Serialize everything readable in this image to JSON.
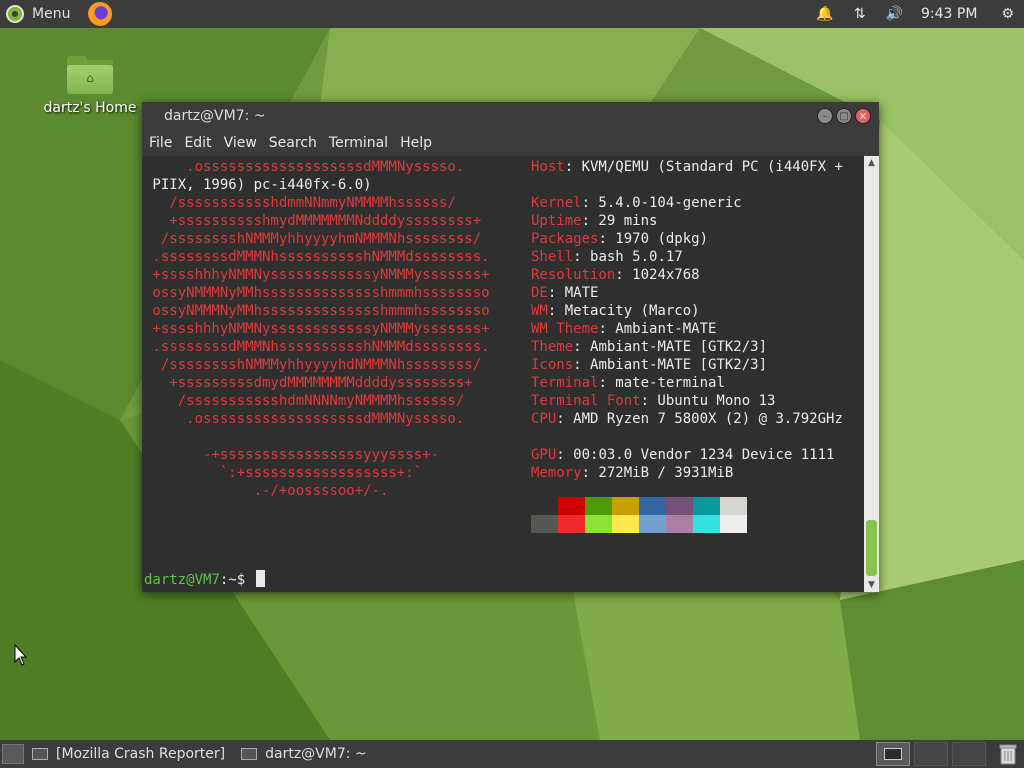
{
  "top_panel": {
    "menu_label": "Menu",
    "clock": "9:43 PM",
    "tray_icons": [
      "notification-bell-icon",
      "network-icon",
      "volume-icon",
      "settings-gear-icon"
    ]
  },
  "desktop": {
    "home_label": "dartz's Home"
  },
  "terminal": {
    "title": "dartz@VM7: ~",
    "menu": [
      "File",
      "Edit",
      "View",
      "Search",
      "Terminal",
      "Help"
    ],
    "host_cont": " PIIX, 1996) pc-i440fx-6.0)",
    "info": [
      {
        "k": "Host",
        "v": ": KVM/QEMU (Standard PC (i440FX +"
      },
      {
        "k": "Kernel",
        "v": ": 5.4.0-104-generic"
      },
      {
        "k": "Uptime",
        "v": ": 29 mins"
      },
      {
        "k": "Packages",
        "v": ": 1970 (dpkg)"
      },
      {
        "k": "Shell",
        "v": ": bash 5.0.17"
      },
      {
        "k": "Resolution",
        "v": ": 1024x768"
      },
      {
        "k": "DE",
        "v": ": MATE"
      },
      {
        "k": "WM",
        "v": ": Metacity (Marco)"
      },
      {
        "k": "WM Theme",
        "v": ": Ambiant-MATE"
      },
      {
        "k": "Theme",
        "v": ": Ambiant-MATE [GTK2/3]"
      },
      {
        "k": "Icons",
        "v": ": Ambiant-MATE [GTK2/3]"
      },
      {
        "k": "Terminal",
        "v": ": mate-terminal"
      },
      {
        "k": "Terminal Font",
        "v": ": Ubuntu Mono 13"
      },
      {
        "k": "CPU",
        "v": ": AMD Ryzen 7 5800X (2) @ 3.792GHz"
      },
      {
        "k": "GPU",
        "v": ": 00:03.0 Vendor 1234 Device 1111"
      },
      {
        "k": "Memory",
        "v": ": 272MiB / 3931MiB"
      }
    ],
    "logo": [
      "     .osssssssssssssssssssdMMMNysssso.",
      "   /ssssssssssshdmmNNmmyNMMMMhssssss/",
      "   +sssssssssshmydMMMMMMMNddddyssssssss+",
      "  /sssssssshNMMMyhhyyyyhmNMMMNhssssssss/",
      " .ssssssssdMMMNhsssssssssshNMMMdssssssss.",
      " +sssshhhyNMMNyssssssssssssyNMMMysssssss+",
      " ossyNMMMNyMMhsssssssssssssshmmmhssssssso",
      " ossyNMMMNyMMhsssssssssssssshmmmhssssssso",
      " +sssshhhyNMMNyssssssssssssyNMMMysssssss+",
      " .ssssssssdMMMNhsssssssssshNMMMdssssssss.",
      "  /sssssssshNMMMyhhyyyyhdNMMMNhssssssss/",
      "   +sssssssssdmydMMMMMMMMddddyssssssss+",
      "    /ssssssssssshdmNNNNmyNMMMMhssssss/",
      "     .osssssssssssssssssssdMMMNysssso.",
      "",
      "       -+sssssssssssssssssyyyssss+-",
      "         `:+ssssssssssssssssss+:`",
      "             .-/+oossssoo+/-."
    ],
    "palette_top": [
      "#2f2f2f",
      "#cc0000",
      "#4e9a06",
      "#c4a000",
      "#3465a4",
      "#75507b",
      "#06989a",
      "#d3d7cf"
    ],
    "palette_bottom": [
      "#555753",
      "#ef2929",
      "#8ae234",
      "#fce94f",
      "#729fcf",
      "#ad7fa8",
      "#34e2e2",
      "#eeeeec"
    ],
    "prompt_user": "dartz@VM7",
    "prompt_rest": ":~$ "
  },
  "taskbar": {
    "tasks": [
      "[Mozilla Crash Reporter]",
      "dartz@VM7: ~"
    ]
  }
}
